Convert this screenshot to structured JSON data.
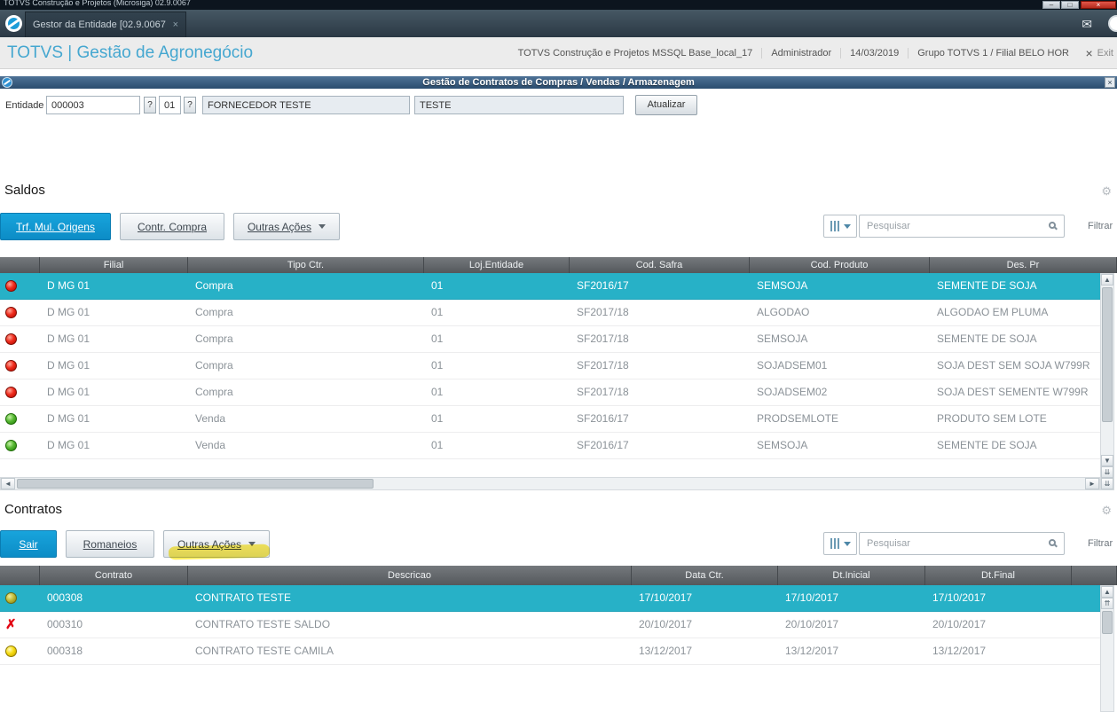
{
  "colors": {
    "accent_blue": "#0d8cc6",
    "selected_row": "#27b1c7",
    "header_gray": "#5f6468",
    "status_red": "#e3180b",
    "status_green": "#46b224",
    "status_yellow": "#f5d800",
    "status_olive": "#b9b431",
    "annotation_yellow": "#ffe93a"
  },
  "icons": {
    "gear": "⚙",
    "envelope": "✉",
    "scroll_up": "▲",
    "scroll_down": "▼",
    "scroll_left": "◄",
    "scroll_right": "►",
    "page_up": "⇈",
    "page_down": "⇊",
    "close": "×",
    "minimize": "–",
    "maximize": "□"
  },
  "window": {
    "title": "TOTVS Construção e Projetos (Microsiga) 02.9.0067"
  },
  "tabs": {
    "active": "Gestor da Entidade [02.9.0067]"
  },
  "appbar": {
    "brand": "TOTVS | Gestão de Agronegócio",
    "environment": "TOTVS Construção e Projetos MSSQL Base_local_17",
    "user": "Administrador",
    "date": "14/03/2019",
    "branch": "Grupo TOTVS 1 / Filial BELO HOR",
    "exit_label": "Exit"
  },
  "dialog": {
    "title": "Gestão de Contratos de Compras / Vendas / Armazenagem"
  },
  "entity_form": {
    "label": "Entidade",
    "code": "000003",
    "lookup": "?",
    "store": "01",
    "name": "FORNECEDOR TESTE",
    "short_name": "TESTE",
    "refresh_button": "Atualizar"
  },
  "saldos": {
    "title": "Saldos",
    "toolbar": {
      "primary": "Trf. Mul. Origens",
      "secondary": "Contr. Compra",
      "more": "Outras Ações",
      "search_placeholder": "Pesquisar",
      "filter": "Filtrar"
    },
    "columns": [
      "Filial",
      "Tipo Ctr.",
      "Loj.Entidade",
      "Cod. Safra",
      "Cod. Produto",
      "Des. Pr"
    ],
    "selected_row_index": 0,
    "rows": [
      {
        "status": "red-circle",
        "filial": "D MG 01",
        "tipo": "Compra",
        "loja": "01",
        "safra": "SF2016/17",
        "produto": "SEMSOJA",
        "descricao": "SEMENTE DE SOJA"
      },
      {
        "status": "red-circle",
        "filial": "D MG 01",
        "tipo": "Compra",
        "loja": "01",
        "safra": "SF2017/18",
        "produto": "ALGODAO",
        "descricao": "ALGODAO EM PLUMA"
      },
      {
        "status": "red-circle",
        "filial": "D MG 01",
        "tipo": "Compra",
        "loja": "01",
        "safra": "SF2017/18",
        "produto": "SEMSOJA",
        "descricao": "SEMENTE DE SOJA"
      },
      {
        "status": "red-circle",
        "filial": "D MG 01",
        "tipo": "Compra",
        "loja": "01",
        "safra": "SF2017/18",
        "produto": "SOJADSEM01",
        "descricao": "SOJA DEST SEM SOJA W799R"
      },
      {
        "status": "red-circle",
        "filial": "D MG 01",
        "tipo": "Compra",
        "loja": "01",
        "safra": "SF2017/18",
        "produto": "SOJADSEM02",
        "descricao": "SOJA DEST SEMENTE W799R"
      },
      {
        "status": "green-circle",
        "filial": "D MG 01",
        "tipo": "Venda",
        "loja": "01",
        "safra": "SF2016/17",
        "produto": "PRODSEMLOTE",
        "descricao": "PRODUTO SEM LOTE"
      },
      {
        "status": "green-circle",
        "filial": "D MG 01",
        "tipo": "Venda",
        "loja": "01",
        "safra": "SF2016/17",
        "produto": "SEMSOJA",
        "descricao": "SEMENTE DE SOJA"
      }
    ]
  },
  "contratos": {
    "title": "Contratos",
    "toolbar": {
      "primary": "Sair",
      "secondary": "Romaneios",
      "more": "Outras Ações",
      "search_placeholder": "Pesquisar",
      "filter": "Filtrar"
    },
    "columns": [
      "Contrato",
      "Descricao",
      "Data Ctr.",
      "Dt.Inicial",
      "Dt.Final"
    ],
    "selected_row_index": 0,
    "rows": [
      {
        "status": "olive-circle",
        "contrato": "000308",
        "descricao": "CONTRATO TESTE",
        "data_ctr": "17/10/2017",
        "dt_inicial": "17/10/2017",
        "dt_final": "17/10/2017"
      },
      {
        "status": "red-x",
        "contrato": "000310",
        "descricao": "CONTRATO TESTE SALDO",
        "data_ctr": "20/10/2017",
        "dt_inicial": "20/10/2017",
        "dt_final": "20/10/2017"
      },
      {
        "status": "yellow-circle",
        "contrato": "000318",
        "descricao": "CONTRATO TESTE CAMILA",
        "data_ctr": "13/12/2017",
        "dt_inicial": "13/12/2017",
        "dt_final": "13/12/2017"
      }
    ]
  }
}
